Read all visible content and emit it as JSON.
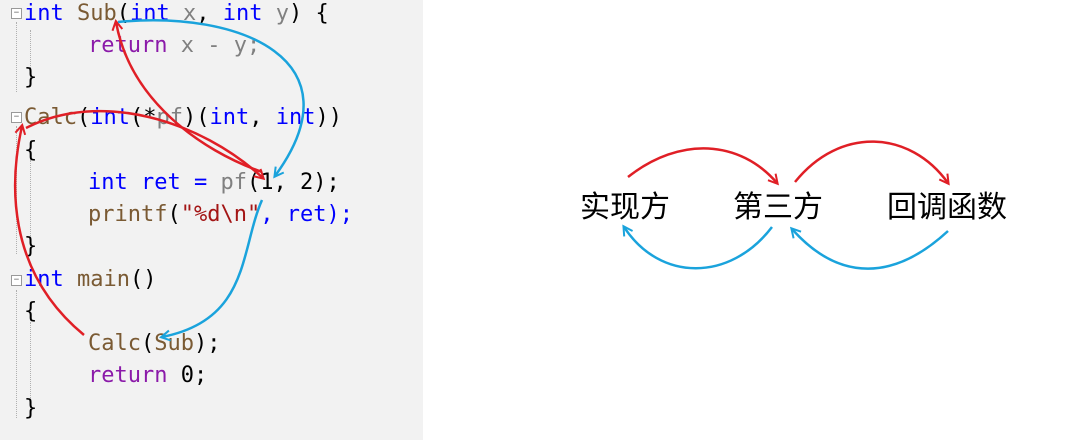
{
  "code": {
    "lines": [
      [
        "int",
        " ",
        "Sub",
        "(",
        "int",
        " ",
        "x",
        ", ",
        "int",
        " ",
        "y",
        ") {"
      ],
      [
        "return",
        " x - y;"
      ],
      [
        "}"
      ],
      [
        "Calc",
        "(",
        "int",
        "(*",
        "pf",
        ")(",
        "int",
        ", ",
        "int",
        "))"
      ],
      [
        "{"
      ],
      [
        "int",
        " ret = ",
        "pf",
        "(1, 2);"
      ],
      [
        "printf",
        "(",
        "\"%d\\n\"",
        ", ret);"
      ],
      [
        "}"
      ],
      [
        "int",
        " ",
        "main",
        "()"
      ],
      [
        "{"
      ],
      [
        "Calc",
        "(",
        "Sub",
        ");"
      ],
      [
        "return",
        " 0;"
      ],
      [
        "}"
      ]
    ]
  },
  "flow": {
    "labels": [
      "实现方",
      "第三方",
      "回调函数"
    ]
  },
  "colors": {
    "red_arrow": "#e01f26",
    "blue_arrow": "#1aa3dc",
    "keyword": "#0000ff",
    "return_keyword": "#8b1aa9",
    "function_name": "#7a5a33",
    "parameter": "#808080",
    "string": "#a31515",
    "panel_background": "#f2f2f2"
  }
}
